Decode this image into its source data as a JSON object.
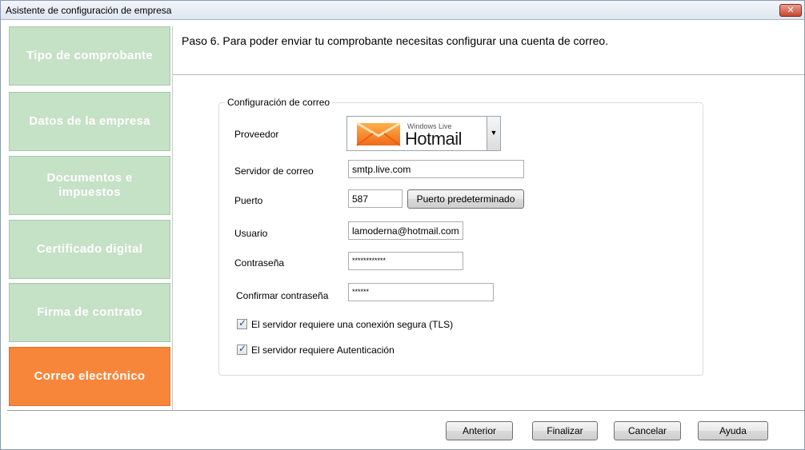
{
  "window": {
    "title": "Asistente de configuración de empresa",
    "close_label": "✕"
  },
  "sidebar": {
    "items": [
      {
        "label": "Tipo de comprobante"
      },
      {
        "label": "Datos de la empresa"
      },
      {
        "label": "Documentos e impuestos"
      },
      {
        "label": "Certificado digital"
      },
      {
        "label": "Firma de contrato"
      },
      {
        "label": "Correo electrónico"
      }
    ],
    "active": "Correo electrónico"
  },
  "header": {
    "text": "Paso 6. Para poder enviar tu comprobante necesitas configurar una cuenta de correo."
  },
  "group": {
    "legend": "Configuración de correo"
  },
  "form": {
    "provider_label": "Proveedor",
    "provider_value": {
      "windows_live": "Windows Live",
      "brand": "Hotmail"
    },
    "server_label": "Servidor de correo",
    "server_value": "smtp.live.com",
    "port_label": "Puerto",
    "port_value": "587",
    "default_port_button": "Puerto predeterminado",
    "user_label": "Usuario",
    "user_value": "lamoderna@hotmail.com",
    "password_label": "Contraseña",
    "password_value": "************",
    "confirm_label": "Confirmar contraseña",
    "confirm_value": "******",
    "tls_label": "El servidor requiere una conexión segura (TLS)",
    "tls_checked": true,
    "auth_label": "El servidor requiere Autenticación",
    "auth_checked": true
  },
  "footer": {
    "prev": "Anterior",
    "finish": "Finalizar",
    "cancel": "Cancelar",
    "help": "Ayuda"
  },
  "colors": {
    "step_inactive": "#c5e1c6",
    "step_active": "#f7863a"
  }
}
